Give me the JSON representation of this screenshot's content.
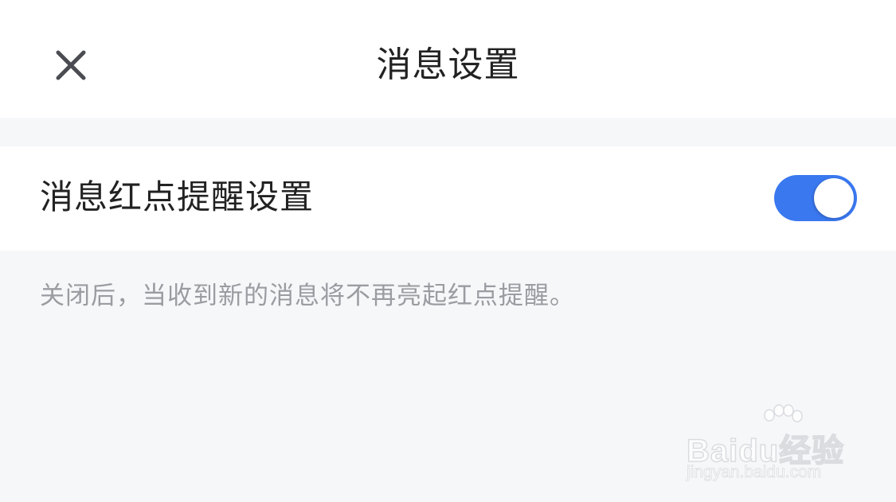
{
  "header": {
    "title": "消息设置",
    "close_icon": "close-icon"
  },
  "settings": {
    "red_dot": {
      "label": "消息红点提醒设置",
      "enabled": true,
      "toggle_color": "#3a78f0"
    },
    "hint": "关闭后，当收到新的消息将不再亮起红点提醒。"
  },
  "watermark": {
    "brand": "Baidu经验",
    "url": "jingyan.baidu.com"
  },
  "colors": {
    "background": "#f6f7f9",
    "card": "#ffffff",
    "accent": "#3a78f0",
    "text_primary": "#222222",
    "text_secondary": "#9a9ca1"
  }
}
